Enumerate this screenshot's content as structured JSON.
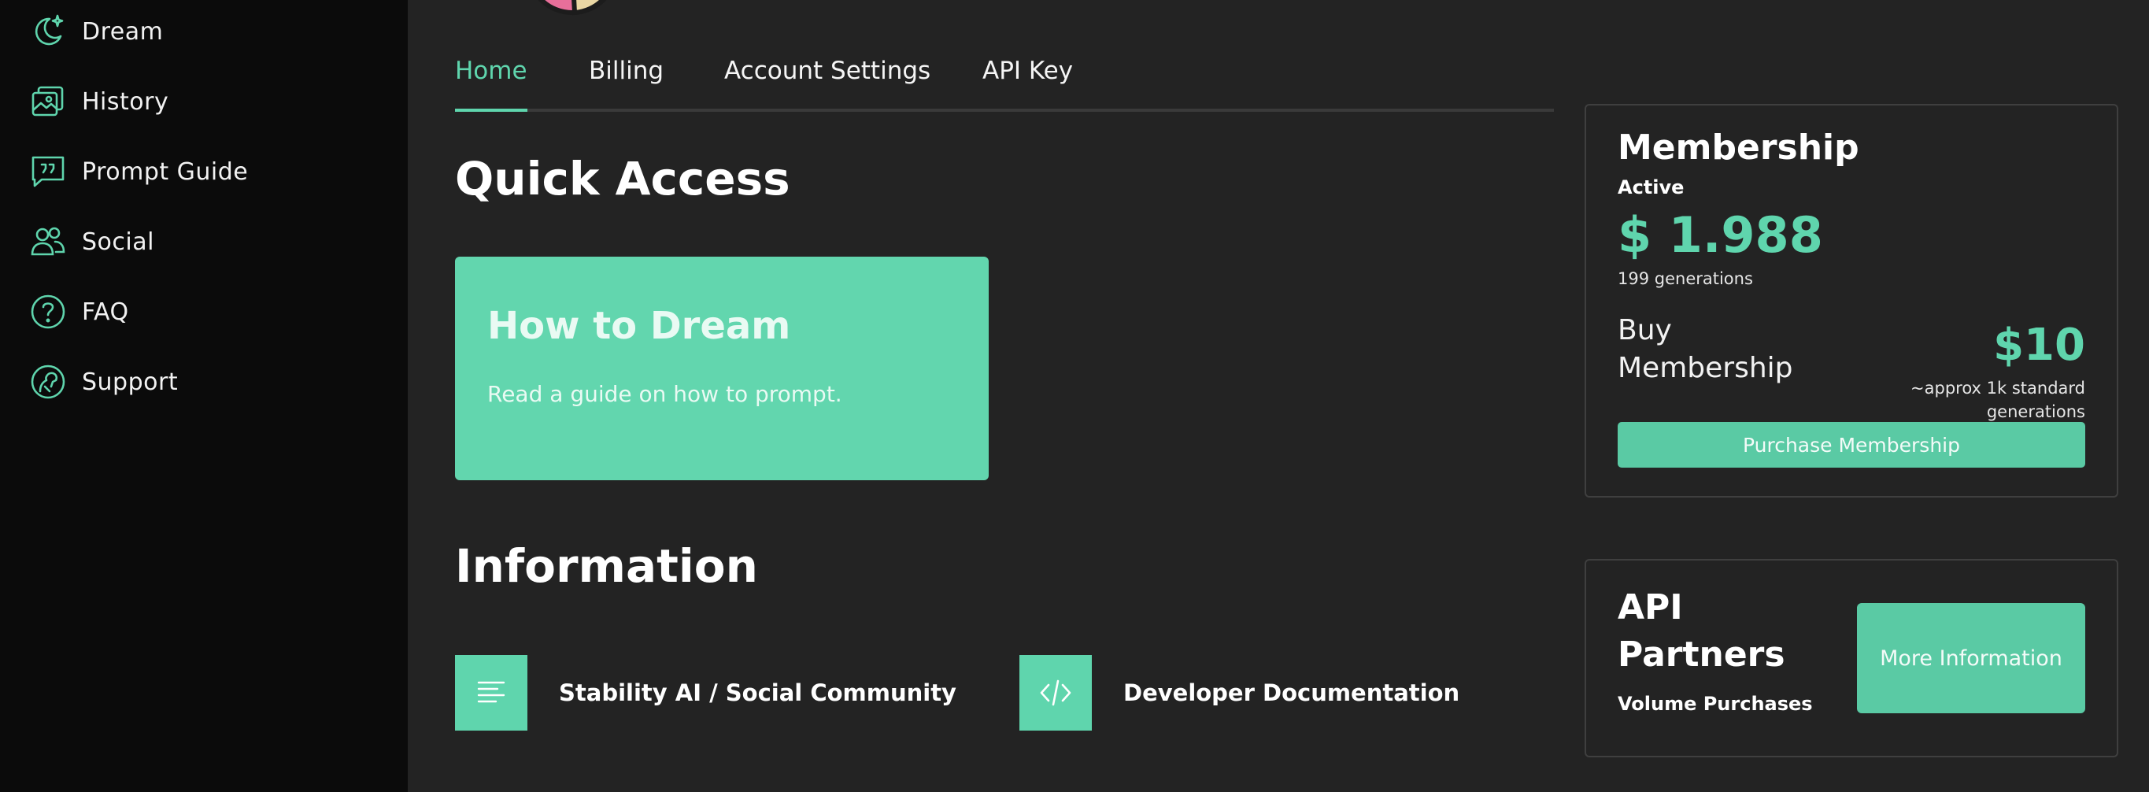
{
  "sidebar": {
    "items": [
      {
        "label": "Dream",
        "icon": "moon-sparkle-icon"
      },
      {
        "label": "History",
        "icon": "image-stack-icon"
      },
      {
        "label": "Prompt Guide",
        "icon": "quote-bubble-icon"
      },
      {
        "label": "Social",
        "icon": "users-icon"
      },
      {
        "label": "FAQ",
        "icon": "question-icon"
      },
      {
        "label": "Support",
        "icon": "support-icon"
      }
    ]
  },
  "tabs": [
    {
      "label": "Home",
      "active": true
    },
    {
      "label": "Billing",
      "active": false
    },
    {
      "label": "Account Settings",
      "active": false
    },
    {
      "label": "API Key",
      "active": false
    }
  ],
  "quick_access": {
    "title": "Quick Access",
    "card": {
      "title": "How to Dream",
      "subtitle": "Read a guide on how to prompt."
    }
  },
  "information": {
    "title": "Information",
    "items": [
      {
        "label": "Stability AI / Social Community",
        "icon": "document-lines-icon"
      },
      {
        "label": "Developer Documentation",
        "icon": "code-icon"
      }
    ]
  },
  "membership": {
    "title": "Membership",
    "status": "Active",
    "balance": "$ 1.988",
    "generations": "199 generations",
    "buy_label": "Buy Membership",
    "price": "$10",
    "approx": "~approx 1k standard generations",
    "button": "Purchase Membership"
  },
  "api_partners": {
    "title": "API Partners",
    "subtitle": "Volume Purchases",
    "button": "More Information"
  },
  "colors": {
    "accent": "#5fd5ad",
    "background": "#232323",
    "sidebar": "#0b0b0b"
  }
}
